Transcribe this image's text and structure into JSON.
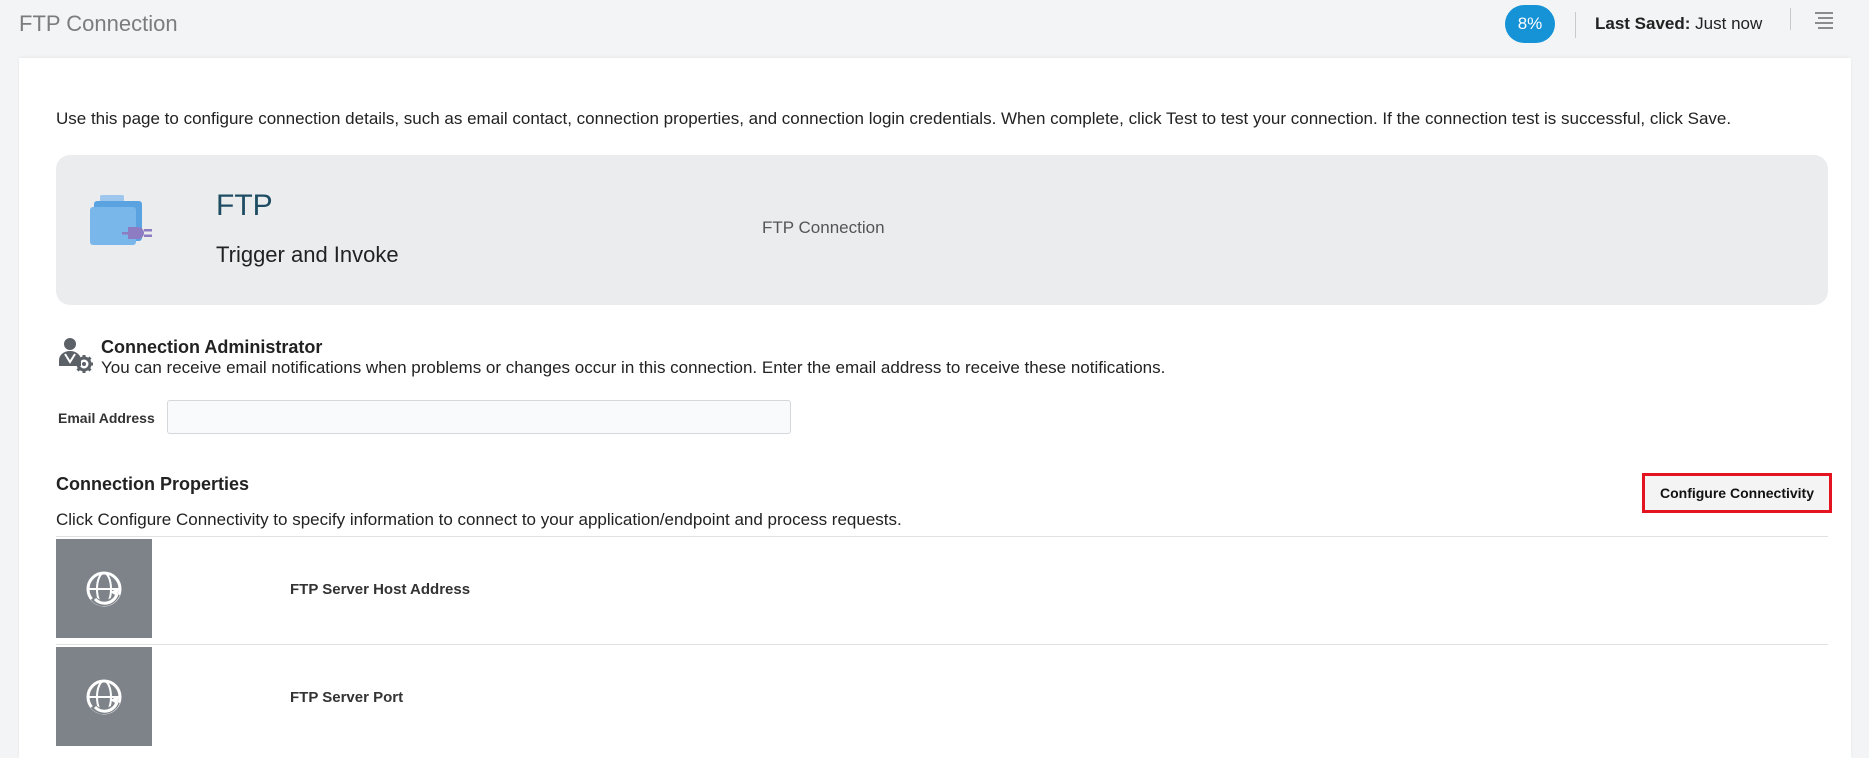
{
  "header": {
    "title": "FTP Connection",
    "progress": "8%",
    "last_saved_label": "Last Saved:",
    "last_saved_value": "Just now",
    "menu_icon": "hamburger-menu-icon"
  },
  "intro": "Use this page to configure connection details, such as email contact, connection properties, and connection login credentials. When complete, click Test to test your connection. If the connection test is successful, click Save.",
  "adapter": {
    "name": "FTP",
    "role": "Trigger and Invoke",
    "connection_name": "FTP Connection",
    "icon": "ftp-adapter-icon"
  },
  "admin": {
    "title": "Connection Administrator",
    "description": "You can receive email notifications when problems or changes occur in this connection. Enter the email address to receive these notifications.",
    "email_label": "Email Address",
    "email_value": "",
    "icon": "admin-settings-icon"
  },
  "properties": {
    "title": "Connection Properties",
    "description": "Click Configure Connectivity to specify information to connect to your application/endpoint and process requests.",
    "configure_label": "Configure Connectivity",
    "items": [
      {
        "label": "FTP Server Host Address",
        "icon": "globe-refresh-icon"
      },
      {
        "label": "FTP Server Port",
        "icon": "globe-refresh-icon"
      }
    ]
  },
  "colors": {
    "accent": "#1593d6",
    "highlight": "#e3141f",
    "tile": "#7d8389",
    "adapter_title": "#1e4d63"
  }
}
